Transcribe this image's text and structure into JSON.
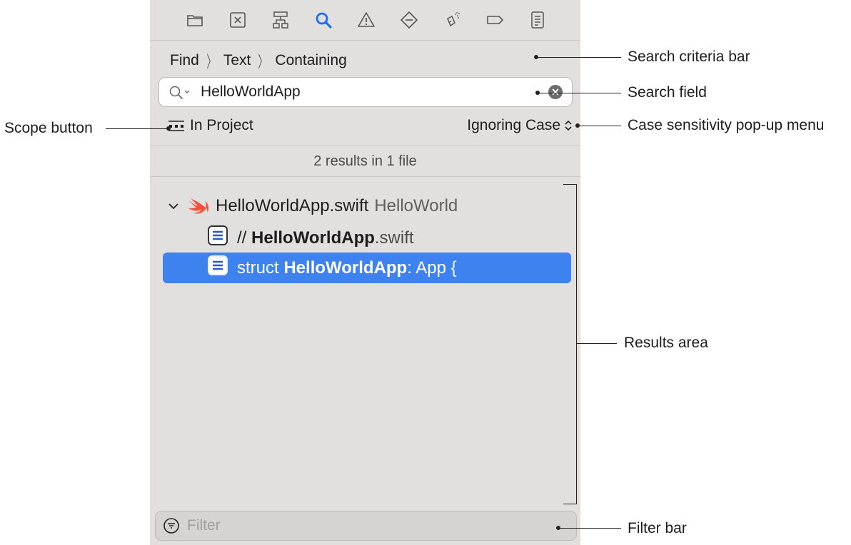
{
  "toolbar": {
    "icons": [
      "folder-icon",
      "source-control-icon",
      "symbol-hierarchy-icon",
      "search-icon",
      "warning-icon",
      "test-diamond-icon",
      "debug-spray-icon",
      "breakpoint-tag-icon",
      "report-list-icon"
    ],
    "active": "search-icon",
    "accent_color": "#1a6ef5"
  },
  "criteria": {
    "find": "Find",
    "text": "Text",
    "containing": "Containing"
  },
  "search": {
    "value": "HelloWorldApp"
  },
  "scope": {
    "label": "In Project"
  },
  "case": {
    "label": "Ignoring Case"
  },
  "results": {
    "count_text": "2 results in 1 file",
    "file": {
      "name": "HelloWorldApp.swift",
      "project": "HelloWorld"
    },
    "matches": [
      {
        "prefix": "// ",
        "match": "HelloWorldApp",
        "suffix": ".swift",
        "selected": false
      },
      {
        "prefix": "struct ",
        "match": "HelloWorldApp",
        "suffix": ": App {",
        "selected": true
      }
    ],
    "selection_color": "#3d82ee"
  },
  "filter": {
    "placeholder": "Filter"
  },
  "callouts": {
    "search_criteria_bar": "Search criteria bar",
    "search_field": "Search field",
    "scope_button": "Scope button",
    "case_menu": "Case sensitivity pop-up menu",
    "results_area": "Results area",
    "filter_bar": "Filter bar"
  }
}
